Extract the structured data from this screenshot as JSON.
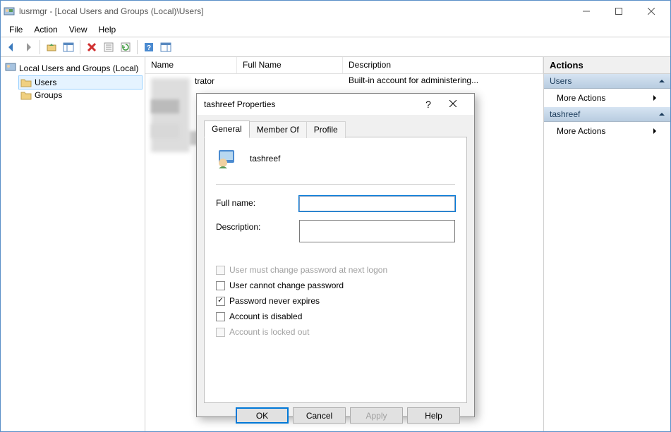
{
  "window": {
    "title": "lusrmgr - [Local Users and Groups (Local)\\Users]"
  },
  "menubar": {
    "file": "File",
    "action": "Action",
    "view": "View",
    "help": "Help"
  },
  "tree": {
    "root": "Local Users and Groups (Local)",
    "users": "Users",
    "groups": "Groups"
  },
  "list": {
    "columns": {
      "name": "Name",
      "fullname": "Full Name",
      "desc": "Description"
    },
    "row0": {
      "name_suffix": "trator",
      "desc": "Built-in account for administering..."
    }
  },
  "actions": {
    "title": "Actions",
    "section1": "Users",
    "more1": "More Actions",
    "section2": "tashreef",
    "more2": "More Actions"
  },
  "dialog": {
    "title": "tashreef Properties",
    "help_symbol": "?",
    "tabs": {
      "general": "General",
      "member_of": "Member Of",
      "profile": "Profile"
    },
    "username": "tashreef",
    "labels": {
      "fullname": "Full name:",
      "description": "Description:"
    },
    "fields": {
      "fullname": "",
      "description": ""
    },
    "checks": {
      "must_change": "User must change password at next logon",
      "cannot_change": "User cannot change password",
      "never_expires": "Password never expires",
      "disabled": "Account is disabled",
      "locked": "Account is locked out"
    },
    "buttons": {
      "ok": "OK",
      "cancel": "Cancel",
      "apply": "Apply",
      "help": "Help"
    }
  }
}
